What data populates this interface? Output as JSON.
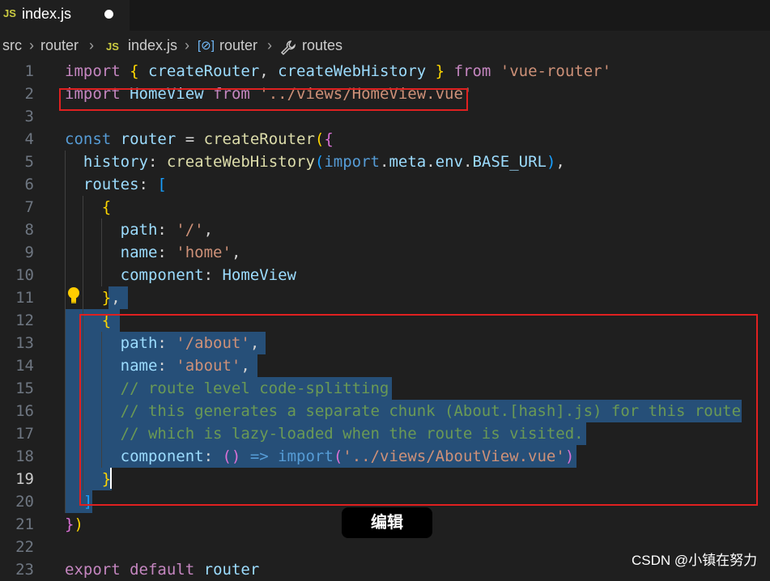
{
  "tab": {
    "icon_label": "JS",
    "filename": "index.js",
    "modified_indicator": "dirty-dot-icon"
  },
  "breadcrumb": {
    "segments": [
      "src",
      "router",
      "index.js",
      "router",
      "routes"
    ],
    "file_badge": "JS",
    "separator_icon": "chevron-right-icon"
  },
  "editor": {
    "active_line": 19,
    "line_numbers": [
      "1",
      "2",
      "3",
      "4",
      "5",
      "6",
      "7",
      "8",
      "9",
      "10",
      "11",
      "12",
      "13",
      "14",
      "15",
      "16",
      "17",
      "18",
      "19",
      "20",
      "21",
      "22",
      "23"
    ],
    "lines": [
      "import { createRouter, createWebHistory } from 'vue-router'",
      "import HomeView from '../views/HomeView.vue'",
      "",
      "const router = createRouter({",
      "  history: createWebHistory(import.meta.env.BASE_URL),",
      "  routes: [",
      "    {",
      "      path: '/',",
      "      name: 'home',",
      "      component: HomeView",
      "    },",
      "    {",
      "      path: '/about',",
      "      name: 'about',",
      "      // route level code-splitting",
      "      // this generates a separate chunk (About.[hash].js) for this route",
      "      // which is lazy-loaded when the route is visited.",
      "      component: () => import('../views/AboutView.vue')",
      "    }",
      "  ]",
      "})",
      "",
      "export default router"
    ]
  },
  "overlay": {
    "tooltip_text": "编辑",
    "watermark": "CSDN @小镇在努力"
  },
  "colors": {
    "background": "#1f1f1f",
    "selection": "#264f78",
    "annotation_box": "#e02020"
  }
}
